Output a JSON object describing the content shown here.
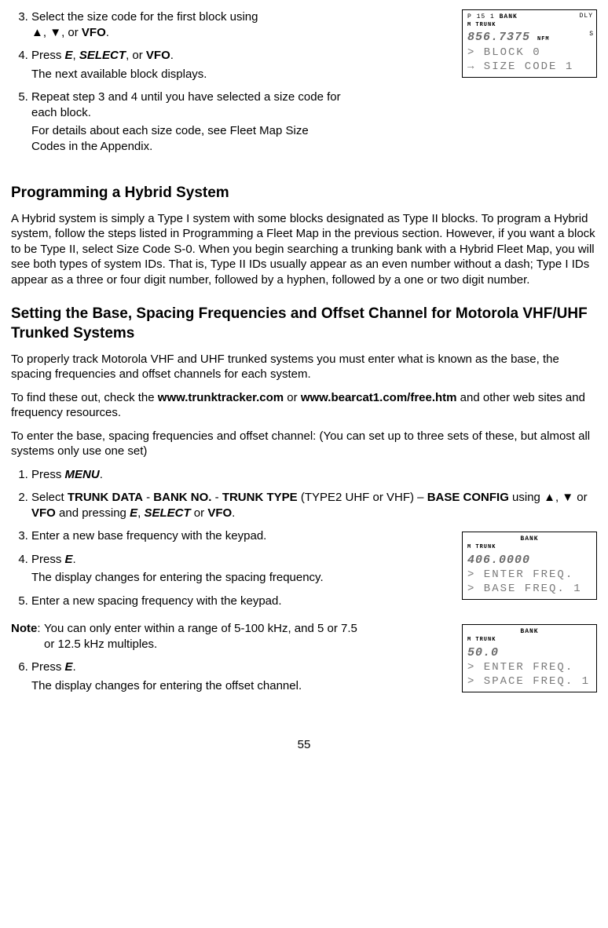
{
  "lcd1": {
    "top_left": "P 15 1",
    "top_bank": "BANK",
    "top_right": "DLY",
    "mode": "M  TRUNK",
    "freq": "856.7375",
    "nfm": "NFM",
    "s": "S",
    "line1": "> BLOCK 0",
    "line2": "→ SIZE CODE 1"
  },
  "lcd2": {
    "top_bank": "BANK",
    "mode": "M  TRUNK",
    "freq": "406.0000",
    "line1": "> ENTER FREQ.",
    "line2": "> BASE FREQ. 1"
  },
  "lcd3": {
    "top_bank": "BANK",
    "mode": "M  TRUNK",
    "freq": " 50.0",
    "line1": "> ENTER FREQ.",
    "line2": "> SPACE FREQ. 1"
  },
  "step3": {
    "text_a": "Select the size code for the first block using",
    "sym_up": "▲",
    "sep1": ", ",
    "sym_dn": "▼",
    "sep2": ", or ",
    "vfo": "VFO",
    "end": "."
  },
  "step4": {
    "a": "Press ",
    "e": "E",
    "sep1": ", ",
    "select": "SELECT",
    "sep2": ", or ",
    "vfo": "VFO",
    "end": ".",
    "sub": "The next available block displays."
  },
  "step5": {
    "a": "Repeat step 3 and 4 until you have selected a size code for each block.",
    "b": "For details about each size code, see Fleet Map Size Codes in the Appendix."
  },
  "h_hybrid": "Programming a Hybrid System",
  "p_hybrid": "A Hybrid system is simply a Type I system with some blocks designated as Type II blocks. To program a Hybrid system, follow the steps listed in Programming a Fleet Map in the previous section. However, if you want a block to be Type II, select Size Code S-0. When you begin searching a trunking bank with a Hybrid Fleet Map, you will see both types of system IDs. That is, Type II IDs usually appear as an even number without a dash; Type I IDs appear as a three or four digit number, followed by a hyphen, followed by a one or two digit number.",
  "h_base": "Setting the Base, Spacing Frequencies and Offset Channel for Motorola VHF/UHF Trunked Systems",
  "p_base1": "To properly track Motorola VHF and UHF trunked systems you must enter what is known as the base, the spacing frequencies and offset channels for each system.",
  "p_base2_a": "To find these out, check the ",
  "p_base2_link1": "www.trunktracker.com",
  "p_base2_b": " or ",
  "p_base2_link2": "www.bearcat1.com/free.htm",
  "p_base2_c": " and other web sites and frequency resources.",
  "p_base3": "To enter the base, spacing frequencies and offset channel: (You can set up to three sets of these, but almost all systems only use one set)",
  "b1": {
    "a": "Press ",
    "menu": "MENU",
    "end": "."
  },
  "b2": {
    "a": "Select ",
    "td": "TRUNK DATA",
    "d1": " - ",
    "bn": "BANK NO.",
    "d2": " - ",
    "tt": "TRUNK TYPE",
    "paren": " (TYPE2 UHF or VHF) – ",
    "bc": "BASE CONFIG",
    "using": " using ",
    "up": "▲",
    "c1": ", ",
    "dn": "▼",
    "or1": " or ",
    "vfo": "VFO",
    "press": " and pressing ",
    "e": "E",
    "c2": ", ",
    "select": "SELECT",
    "or2": " or ",
    "vfo2": "VFO",
    "end": "."
  },
  "b3": "Enter a new base frequency with the keypad.",
  "b4": {
    "a": "Press ",
    "e": "E",
    "end": ".",
    "sub": "The display changes for entering the spacing frequency."
  },
  "b5": "Enter a new spacing frequency with the keypad.",
  "note": {
    "label": "Note",
    "colon": ":",
    "text": "You can only enter within a range of 5-100 kHz, and 5 or 7.5 or 12.5 kHz multiples."
  },
  "b6": {
    "a": "Press ",
    "e": "E",
    "end": ".",
    "sub": "The display changes for entering the offset channel."
  },
  "page": "55"
}
